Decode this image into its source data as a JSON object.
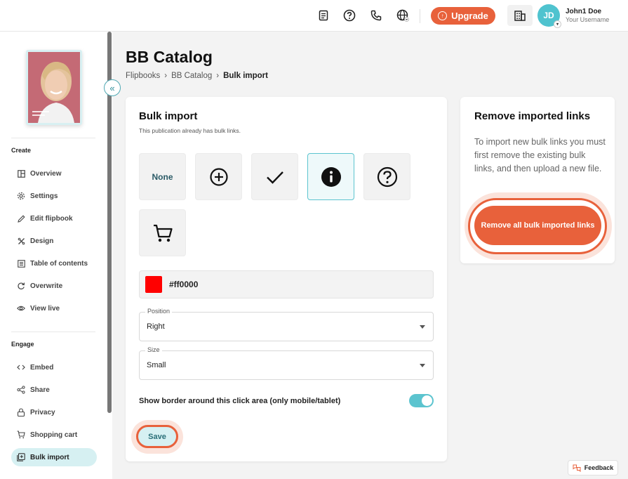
{
  "header": {
    "icons": [
      "document-icon",
      "help-icon",
      "phone-icon",
      "globe-icon"
    ],
    "upgrade_label": "Upgrade",
    "user": {
      "initials": "JD",
      "name": "John1 Doe",
      "username": "Your Username"
    }
  },
  "sidebar": {
    "sections": [
      {
        "heading": "Create",
        "items": [
          {
            "label": "Overview",
            "icon": "layout-icon"
          },
          {
            "label": "Settings",
            "icon": "gear-icon"
          },
          {
            "label": "Edit flipbook",
            "icon": "pencil-icon"
          },
          {
            "label": "Design",
            "icon": "design-icon"
          },
          {
            "label": "Table of contents",
            "icon": "list-icon"
          },
          {
            "label": "Overwrite",
            "icon": "refresh-icon"
          },
          {
            "label": "View live",
            "icon": "eye-icon"
          }
        ]
      },
      {
        "heading": "Engage",
        "items": [
          {
            "label": "Embed",
            "icon": "code-icon"
          },
          {
            "label": "Share",
            "icon": "share-icon"
          },
          {
            "label": "Privacy",
            "icon": "lock-icon"
          },
          {
            "label": "Shopping cart",
            "icon": "cart-icon"
          },
          {
            "label": "Bulk import",
            "icon": "bulk-import-icon",
            "active": true
          }
        ]
      }
    ]
  },
  "page": {
    "title": "BB Catalog",
    "breadcrumb": [
      "Flipbooks",
      "BB Catalog",
      "Bulk import"
    ]
  },
  "bulk_import": {
    "title": "Bulk import",
    "subtitle": "This publication already has bulk links.",
    "icon_options": [
      {
        "name": "none",
        "label": "None"
      },
      {
        "name": "plus-circle-icon"
      },
      {
        "name": "checkmark-icon"
      },
      {
        "name": "info-icon",
        "selected": true
      },
      {
        "name": "question-icon"
      },
      {
        "name": "cart-icon"
      }
    ],
    "color": {
      "value": "#ff0000",
      "label": "#ff0000"
    },
    "position": {
      "legend": "Position",
      "value": "Right"
    },
    "size": {
      "legend": "Size",
      "value": "Small"
    },
    "border_toggle": {
      "label": "Show border around this click area (only mobile/tablet)",
      "on": true
    },
    "save_label": "Save"
  },
  "remove_panel": {
    "title": "Remove imported links",
    "description": "To import new bulk links you must first remove the existing bulk links, and then upload a new file.",
    "button_label": "Remove all bulk imported links"
  },
  "feedback_label": "Feedback",
  "colors": {
    "accent": "#e8613b",
    "teal": "#5cc4cf",
    "active_bg": "#d6f0f2"
  }
}
